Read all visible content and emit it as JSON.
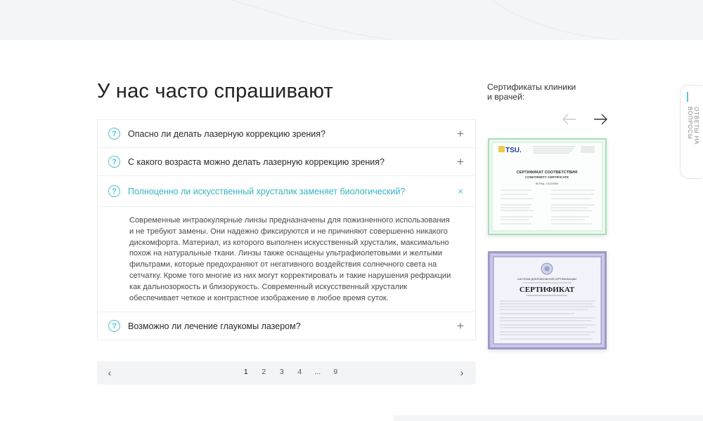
{
  "faq": {
    "title": "У нас часто спрашивают",
    "items": [
      {
        "question": "Опасно ли делать лазерную коррекцию зрения?",
        "toggle": "+",
        "state": "collapsed"
      },
      {
        "question": "С какого возраста можно делать лазерную коррекцию зрения?",
        "toggle": "+",
        "state": "collapsed"
      },
      {
        "question": "Полноценно ли искусственный хрусталик заменяет биологический?",
        "toggle": "×",
        "state": "expanded",
        "answer": "Современные интраокулярные линзы предназначены для пожизненного использования и не требуют замены.  Они надежно фиксируются и не причиняют совершенно никакого дискомфорта. Материал, из которого выполнен искусственный хрусталик, максимально похож на натуральные ткани. Линзы также оснащены ультрафиолетовыми и желтыми фильтрами, которые предохраняют от негативного воздействия солнечного света на сетчатку. Кроме того многие из них могут корректировать и такие нарушения рефракции как дальнозоркость и близорукость. Современный искусственный хрусталик обеспечивает четкое и контрастное изображение в любое время суток."
      },
      {
        "question": "Возможно ли лечение глаукомы лазером?",
        "toggle": "+",
        "state": "collapsed"
      }
    ],
    "question_icon_glyph": "?"
  },
  "pagination": {
    "prev_glyph": "‹",
    "next_glyph": "›",
    "pages": [
      "1",
      "2",
      "3",
      "4",
      "...",
      "9"
    ],
    "current": "1"
  },
  "certificates": {
    "title_line1": "Сертификаты клиники",
    "title_line2": "и врачей:",
    "items": [
      {
        "logo": "TSU.",
        "heading_line1": "СЕРТИФИКАТ СООТВЕТСТВИЯ",
        "heading_line2": "CONFORMITY CERTIFICATE",
        "number": "№ Reg. 15120090"
      },
      {
        "system_line": "СИСТЕМА ДОБРОВОЛЬНОЙ СЕРТИФИКАЦИИ",
        "title": "СЕРТИФИКАТ"
      }
    ]
  },
  "side_tab": {
    "label": "ОТВЕТЫ НА ВОПРОСЫ"
  },
  "colors": {
    "accent": "#4fc3cf",
    "active_question": "#34b4c2",
    "pager_bg": "#f3f4f6",
    "cert1_border": "#a6dfb9",
    "cert2_border": "#9b9ac9"
  },
  "icons": {
    "question": "question-circle-icon",
    "expand": "plus-icon",
    "collapse": "close-icon",
    "arrow_prev": "arrow-left-icon",
    "arrow_next": "arrow-right-icon"
  }
}
